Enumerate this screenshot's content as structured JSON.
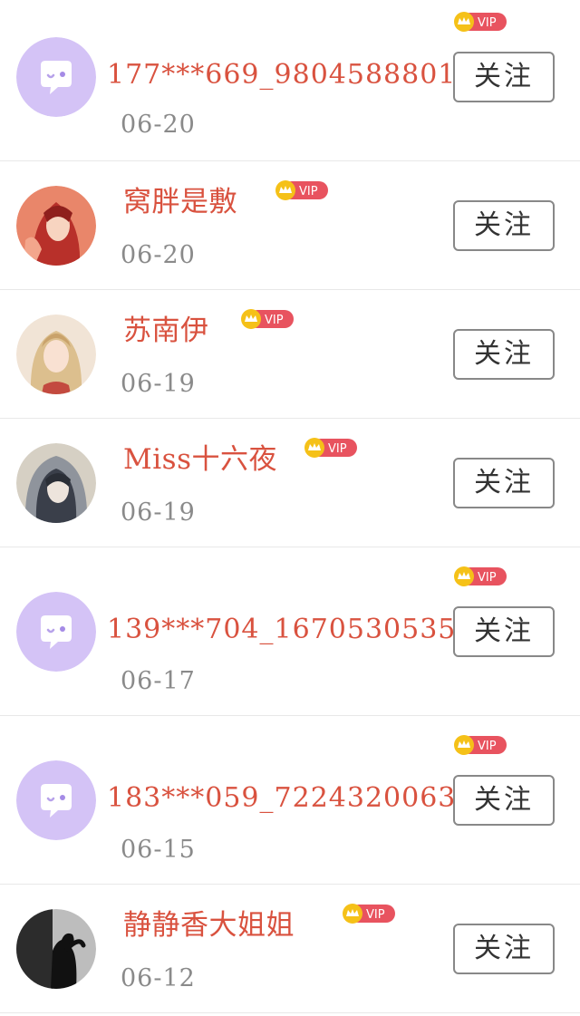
{
  "colors": {
    "name": "#d9523f",
    "date": "#8a8a8a",
    "vip_badge": "#e8535f",
    "crown": "#f5c118",
    "default_avatar_bg": "#d4c3f6"
  },
  "follow_label": "关注",
  "vip_label": "VIP",
  "users": [
    {
      "name": "177***669_9804588801",
      "date": "06-20",
      "vip": true,
      "avatar": "default-avatar"
    },
    {
      "name": "窝胖是敷",
      "date": "06-20",
      "vip": true,
      "avatar": "red-hair-girl-avatar"
    },
    {
      "name": "苏南伊",
      "date": "06-19",
      "vip": true,
      "avatar": "blonde-girl-avatar"
    },
    {
      "name": "Miss十六夜",
      "date": "06-19",
      "vip": true,
      "avatar": "hooded-girl-avatar"
    },
    {
      "name": "139***704_1670530535",
      "date": "06-17",
      "vip": true,
      "avatar": "default-avatar"
    },
    {
      "name": "183***059_7224320063",
      "date": "06-15",
      "vip": true,
      "avatar": "default-avatar"
    },
    {
      "name": "静静香大姐姐",
      "date": "06-12",
      "vip": true,
      "avatar": "dark-silhouette-avatar"
    }
  ]
}
